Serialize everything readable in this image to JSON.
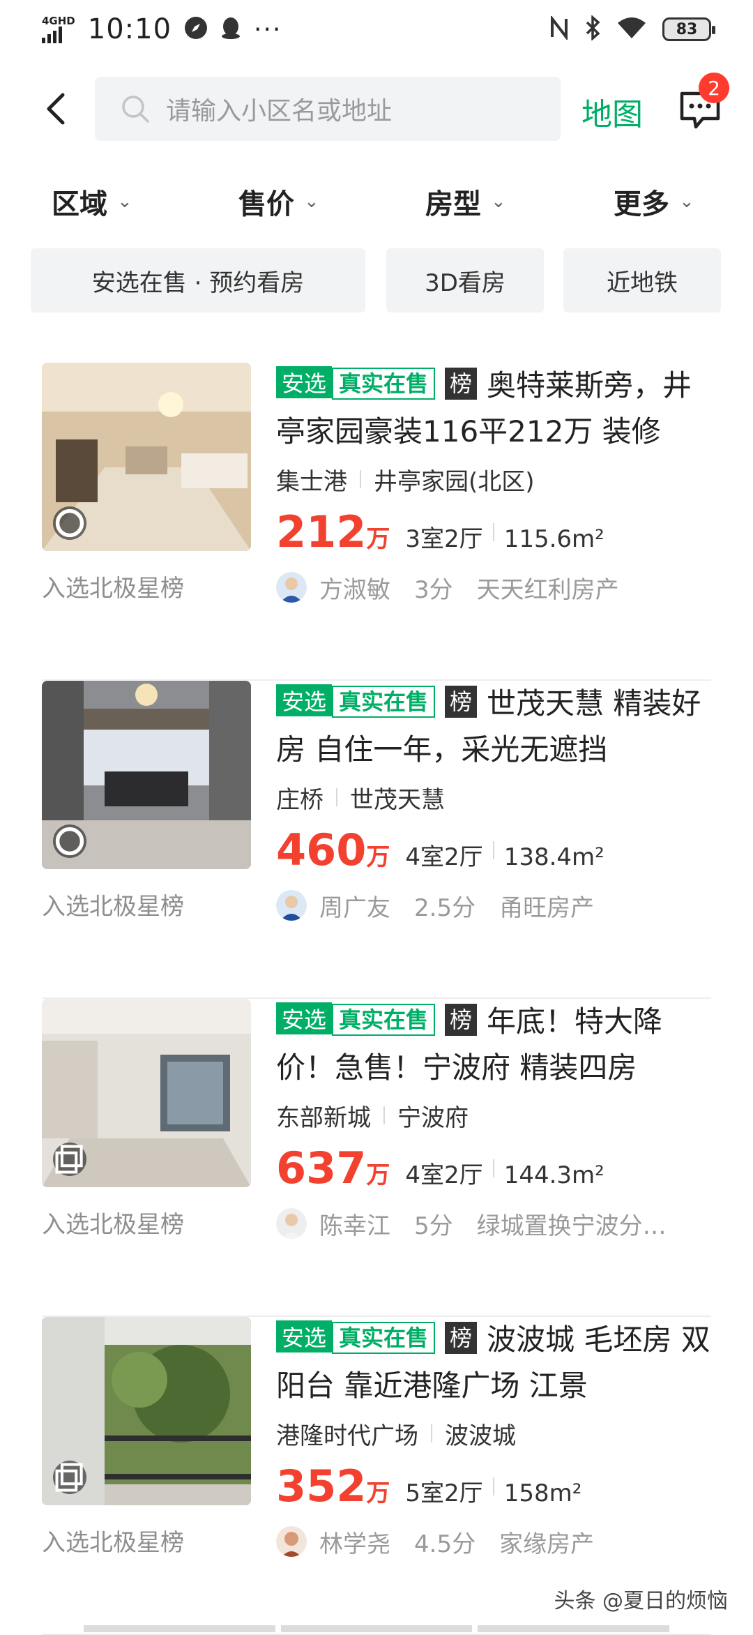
{
  "status_bar": {
    "network": "4GHD",
    "time": "10:10",
    "more": "···",
    "icons": [
      "nfc-icon",
      "bluetooth-icon",
      "wifi-icon"
    ],
    "battery": "83"
  },
  "header": {
    "search_placeholder": "请输入小区名或地址",
    "map_label": "地图",
    "message_badge": "2"
  },
  "filters": [
    {
      "label": "区域"
    },
    {
      "label": "售价"
    },
    {
      "label": "房型"
    },
    {
      "label": "更多"
    }
  ],
  "chips": [
    {
      "label": "安选在售 · 预约看房"
    },
    {
      "label": "3D看房"
    },
    {
      "label": "近地铁"
    }
  ],
  "tags": {
    "anxuan": "安选",
    "real": "真实在售",
    "rank": "榜"
  },
  "listings": [
    {
      "title": "奥特莱斯旁，井亭家园豪装116平212万 装修",
      "district": "集士港",
      "community": "井亭家园(北区)",
      "price": "212",
      "price_unit": "万",
      "layout": "3室2厅",
      "area": "115.6m²",
      "agent": "方淑敏",
      "score": "3分",
      "company": "天天红利房产",
      "rank_caption": "入选北极星榜"
    },
    {
      "title": "世茂天慧 精装好房 自住一年，采光无遮挡",
      "district": "庄桥",
      "community": "世茂天慧",
      "price": "460",
      "price_unit": "万",
      "layout": "4室2厅",
      "area": "138.4m²",
      "agent": "周广友",
      "score": "2.5分",
      "company": "甬旺房产",
      "rank_caption": "入选北极星榜"
    },
    {
      "title": "年底！特大降价！急售！宁波府 精装四房",
      "district": "东部新城",
      "community": "宁波府",
      "price": "637",
      "price_unit": "万",
      "layout": "4室2厅",
      "area": "144.3m²",
      "agent": "陈幸江",
      "score": "5分",
      "company": "绿城置换宁波分公司",
      "rank_caption": "入选北极星榜"
    },
    {
      "title": "波波城  毛坯房 双阳台 靠近港隆广场 江景",
      "district": "港隆时代广场",
      "community": "波波城",
      "price": "352",
      "price_unit": "万",
      "layout": "5室2厅",
      "area": "158m²",
      "agent": "林学尧",
      "score": "4.5分",
      "company": "家缘房产",
      "rank_caption": "入选北极星榜"
    }
  ],
  "watermark": "头条 @夏日的烦恼",
  "colors": {
    "brand_green": "#00ae66",
    "price_red": "#f2412f",
    "badge_red": "#ff3b30"
  }
}
